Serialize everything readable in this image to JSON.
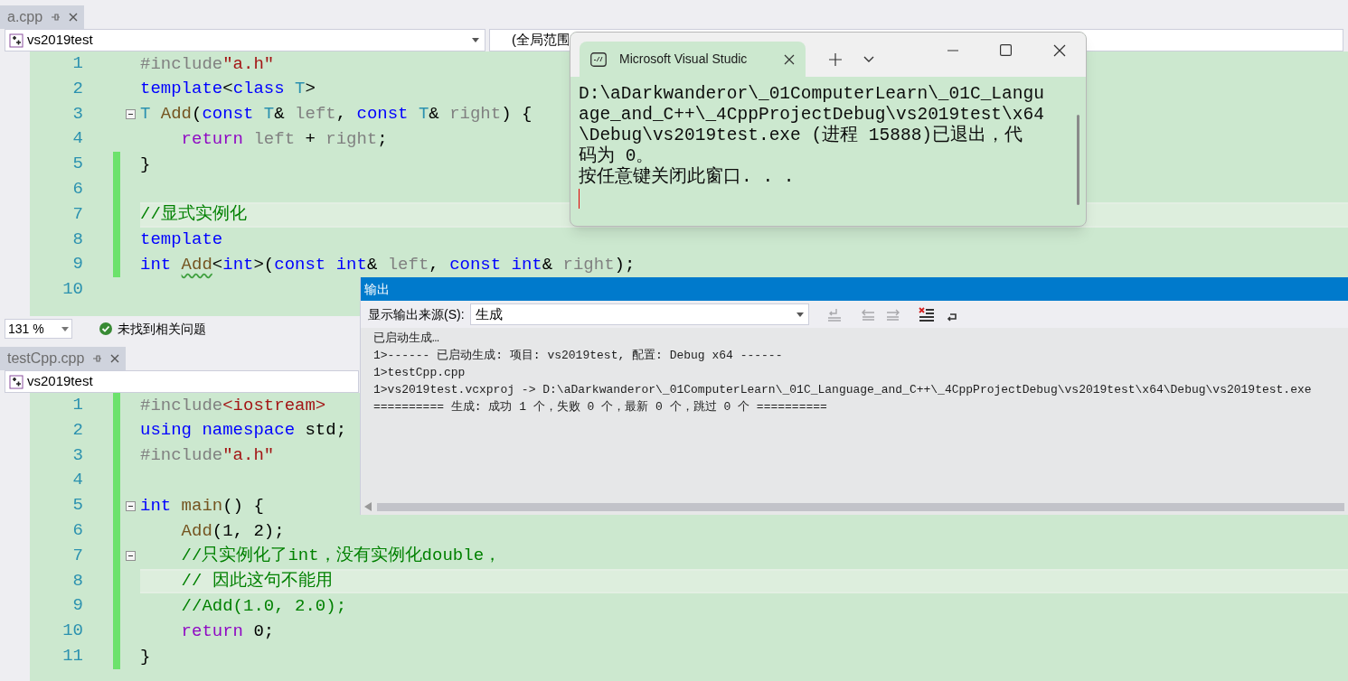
{
  "top_editor": {
    "tab": {
      "label": "a.cpp",
      "selected": false
    },
    "project": "vs2019test",
    "scope": "(全局范围",
    "lines": [
      {
        "number": "1",
        "changed": false,
        "current": false,
        "fold_marker": false,
        "tokens": [
          {
            "kind": "preproc",
            "text": "#include"
          },
          {
            "kind": "string",
            "text": "\"a.h\""
          }
        ]
      },
      {
        "number": "2",
        "changed": false,
        "current": false,
        "fold_marker": false,
        "tokens": [
          {
            "kind": "keyword",
            "text": "template"
          },
          {
            "kind": "plain",
            "text": "<"
          },
          {
            "kind": "keyword",
            "text": "class "
          },
          {
            "kind": "type",
            "text": "T"
          },
          {
            "kind": "plain",
            "text": ">"
          }
        ]
      },
      {
        "number": "3",
        "changed": false,
        "current": false,
        "fold_marker": true,
        "tokens": [
          {
            "kind": "type",
            "text": "T "
          },
          {
            "kind": "function",
            "text": "Add"
          },
          {
            "kind": "plain",
            "text": "("
          },
          {
            "kind": "keyword",
            "text": "const "
          },
          {
            "kind": "type",
            "text": "T"
          },
          {
            "kind": "plain",
            "text": "& "
          },
          {
            "kind": "param",
            "text": "left"
          },
          {
            "kind": "plain",
            "text": ", "
          },
          {
            "kind": "keyword",
            "text": "const "
          },
          {
            "kind": "type",
            "text": "T"
          },
          {
            "kind": "plain",
            "text": "& "
          },
          {
            "kind": "param",
            "text": "right"
          },
          {
            "kind": "plain",
            "text": ") {"
          }
        ]
      },
      {
        "number": "4",
        "changed": false,
        "current": false,
        "fold_marker": false,
        "tokens": [
          {
            "kind": "control",
            "text": "    return "
          },
          {
            "kind": "param",
            "text": "left"
          },
          {
            "kind": "plain",
            "text": " + "
          },
          {
            "kind": "param",
            "text": "right"
          },
          {
            "kind": "plain",
            "text": ";"
          }
        ]
      },
      {
        "number": "5",
        "changed": true,
        "current": false,
        "fold_marker": false,
        "tokens": [
          {
            "kind": "plain",
            "text": "}"
          }
        ]
      },
      {
        "number": "6",
        "changed": true,
        "current": false,
        "fold_marker": false
      },
      {
        "number": "7",
        "changed": true,
        "current": true,
        "fold_marker": false,
        "tokens": [
          {
            "kind": "comment",
            "text": "//显式实例化"
          }
        ]
      },
      {
        "number": "8",
        "changed": true,
        "current": false,
        "fold_marker": false,
        "tokens": [
          {
            "kind": "keyword",
            "text": "template"
          }
        ]
      },
      {
        "number": "9",
        "changed": true,
        "current": false,
        "fold_marker": false,
        "tokens": [
          {
            "kind": "keyword",
            "text": "int "
          },
          {
            "kind": "function",
            "text": "Add",
            "warning": true
          },
          {
            "kind": "plain",
            "text": "<"
          },
          {
            "kind": "keyword",
            "text": "int"
          },
          {
            "kind": "plain",
            "text": ">("
          },
          {
            "kind": "keyword",
            "text": "const int"
          },
          {
            "kind": "plain",
            "text": "& "
          },
          {
            "kind": "param",
            "text": "left"
          },
          {
            "kind": "plain",
            "text": ", "
          },
          {
            "kind": "keyword",
            "text": "const int"
          },
          {
            "kind": "plain",
            "text": "& "
          },
          {
            "kind": "param",
            "text": "right"
          },
          {
            "kind": "plain",
            "text": ");"
          }
        ]
      },
      {
        "number": "10",
        "changed": false,
        "current": false,
        "fold_marker": false
      }
    ],
    "status_bar": {
      "zoom": "131 %",
      "issues": "未找到相关问题"
    }
  },
  "bottom_editor": {
    "tab": {
      "label": "testCpp.cpp",
      "selected": false
    },
    "project": "vs2019test",
    "lines": [
      {
        "number": "1",
        "changed": true,
        "current": false,
        "fold_marker": false,
        "tokens": [
          {
            "kind": "preproc",
            "text": "#include"
          },
          {
            "kind": "string",
            "text": "<iostream>"
          }
        ]
      },
      {
        "number": "2",
        "changed": true,
        "current": false,
        "fold_marker": false,
        "tokens": [
          {
            "kind": "keyword",
            "text": "using namespace"
          },
          {
            "kind": "plain",
            "text": " std;"
          }
        ]
      },
      {
        "number": "3",
        "changed": true,
        "current": false,
        "fold_marker": false,
        "tokens": [
          {
            "kind": "preproc",
            "text": "#include"
          },
          {
            "kind": "string",
            "text": "\"a.h\""
          }
        ]
      },
      {
        "number": "4",
        "changed": true,
        "current": false,
        "fold_marker": false
      },
      {
        "number": "5",
        "changed": true,
        "current": false,
        "fold_marker": true,
        "tokens": [
          {
            "kind": "keyword",
            "text": "int "
          },
          {
            "kind": "function",
            "text": "main"
          },
          {
            "kind": "plain",
            "text": "() {"
          }
        ]
      },
      {
        "number": "6",
        "changed": true,
        "current": false,
        "fold_marker": false,
        "tokens": [
          {
            "kind": "function",
            "text": "    Add"
          },
          {
            "kind": "plain",
            "text": "(1, 2);"
          }
        ]
      },
      {
        "number": "7",
        "changed": true,
        "current": false,
        "fold_marker": true,
        "tokens": [
          {
            "kind": "comment",
            "text": "    //只实例化了int，没有实例化double，"
          }
        ]
      },
      {
        "number": "8",
        "changed": true,
        "current": true,
        "fold_marker": false,
        "tokens": [
          {
            "kind": "comment",
            "text": "    // 因此这句不能用"
          }
        ]
      },
      {
        "number": "9",
        "changed": true,
        "current": false,
        "fold_marker": false,
        "tokens": [
          {
            "kind": "comment",
            "text": "    //Add(1.0, 2.0);"
          }
        ]
      },
      {
        "number": "10",
        "changed": true,
        "current": false,
        "fold_marker": false,
        "tokens": [
          {
            "kind": "control",
            "text": "    return "
          },
          {
            "kind": "plain",
            "text": "0;"
          }
        ]
      },
      {
        "number": "11",
        "changed": true,
        "current": false,
        "fold_marker": false,
        "tokens": [
          {
            "kind": "plain",
            "text": "}"
          }
        ]
      }
    ]
  },
  "output_panel": {
    "title": "输出",
    "source_label": "显示输出来源(S):",
    "source_value": "生成",
    "tools": [
      {
        "kind": "goto",
        "disabled": true
      },
      {
        "kind": "prev",
        "disabled": true
      },
      {
        "kind": "next",
        "disabled": true
      },
      {
        "kind": "clear",
        "disabled": false
      },
      {
        "kind": "wrap",
        "disabled": false
      }
    ],
    "lines": [
      "已启动生成…",
      "1>------ 已启动生成: 项目: vs2019test, 配置: Debug x64 ------",
      "1>testCpp.cpp",
      "1>vs2019test.vcxproj -> D:\\aDarkwanderor\\_01ComputerLearn\\_01C_Language_and_C++\\_4CppProjectDebug\\vs2019test\\x64\\Debug\\vs2019test.exe",
      "========== 生成: 成功 1 个，失败 0 个，最新 0 个，跳过 0 个 =========="
    ]
  },
  "console_window": {
    "title": "Microsoft Visual Studic",
    "lines": [
      "D:\\aDarkwanderor\\_01ComputerLearn\\_01C_Langu",
      "age_and_C++\\_4CppProjectDebug\\vs2019test\\x64",
      "\\Debug\\vs2019test.exe (进程 15888)已退出，代",
      "码为 0。",
      "按任意键关闭此窗口. . ."
    ],
    "cursor": true
  }
}
